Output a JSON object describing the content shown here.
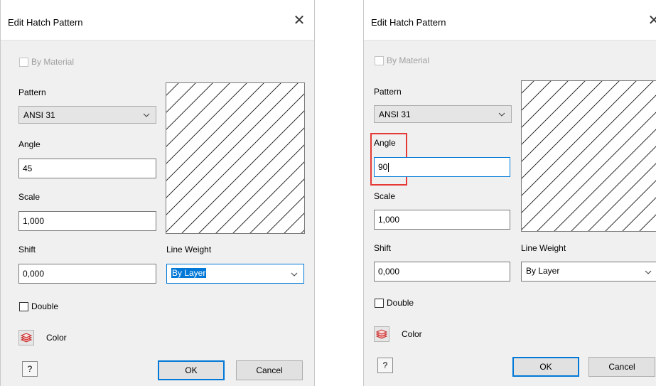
{
  "left_dialog": {
    "title": "Edit Hatch Pattern",
    "close_glyph": "✕",
    "by_material_label": "By Material",
    "pattern_label": "Pattern",
    "pattern_value": "ANSI 31",
    "angle_label": "Angle",
    "angle_value": "45",
    "scale_label": "Scale",
    "scale_value": "1,000",
    "shift_label": "Shift",
    "shift_value": "0,000",
    "line_weight_label": "Line Weight",
    "line_weight_value": "By Layer",
    "double_label": "Double",
    "color_label": "Color",
    "help_glyph": "?",
    "ok_label": "OK",
    "cancel_label": "Cancel"
  },
  "right_dialog": {
    "title": "Edit Hatch Pattern",
    "close_glyph": "✕",
    "by_material_label": "By Material",
    "pattern_label": "Pattern",
    "pattern_value": "ANSI 31",
    "angle_label": "Angle",
    "angle_value": "90",
    "scale_label": "Scale",
    "scale_value": "1,000",
    "shift_label": "Shift",
    "shift_value": "0,000",
    "line_weight_label": "Line Weight",
    "line_weight_value": "By Layer",
    "double_label": "Double",
    "color_label": "Color",
    "help_glyph": "?",
    "ok_label": "OK",
    "cancel_label": "Cancel"
  },
  "icons": {
    "close": "close-icon",
    "chevron": "chevron-down-icon",
    "color": "layers-color-icon",
    "help": "help-icon"
  },
  "colors": {
    "dialog_bg": "#f0f0f0",
    "accent": "#0078d7",
    "highlight": "#e53935"
  }
}
